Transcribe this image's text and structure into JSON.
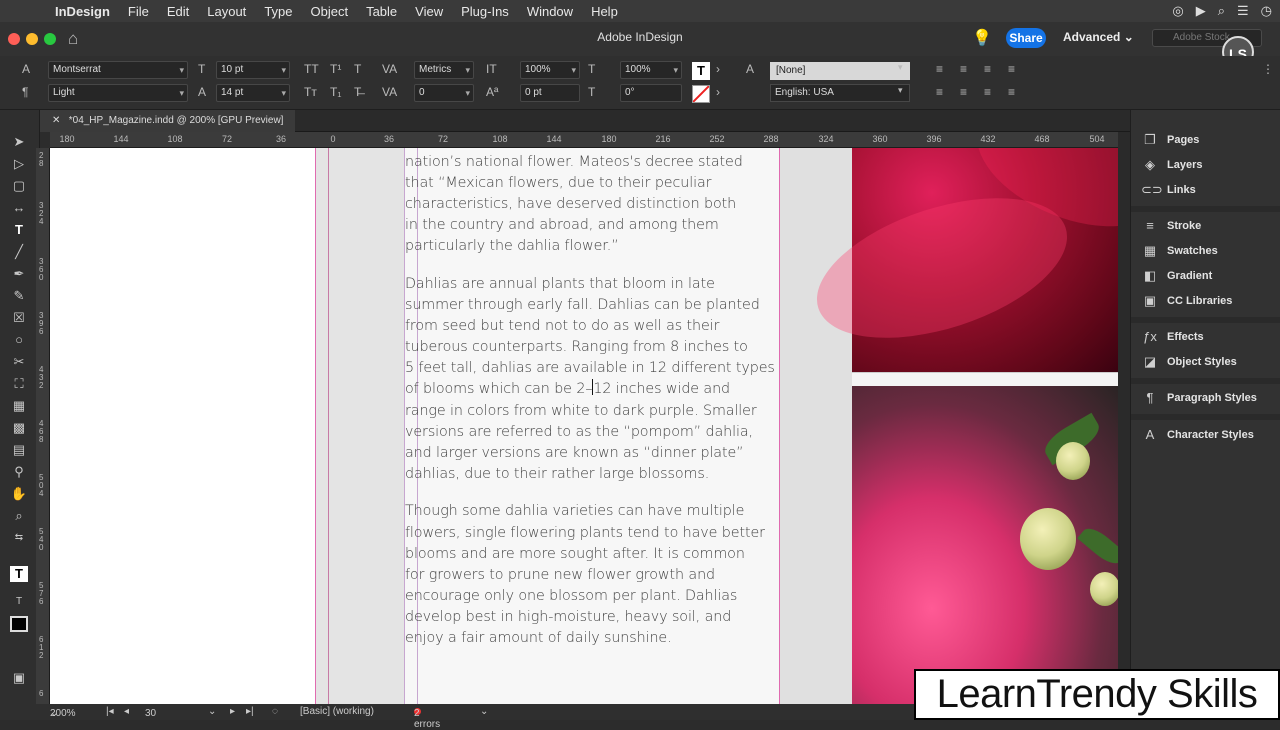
{
  "menubar": {
    "app": "InDesign",
    "items": [
      "File",
      "Edit",
      "Layout",
      "Type",
      "Object",
      "Table",
      "View",
      "Plug-Ins",
      "Window",
      "Help"
    ]
  },
  "titlebar": {
    "title": "Adobe InDesign",
    "share": "Share",
    "workspace": "Advanced",
    "stock_placeholder": "Adobe Stock",
    "badge": "LS"
  },
  "control": {
    "font_family": "Montserrat",
    "font_style": "Light",
    "font_size": "10 pt",
    "leading": "14 pt",
    "kerning": "Metrics",
    "tracking": "0",
    "vertical_scale": "100%",
    "horizontal_scale": "100%",
    "baseline_shift": "0 pt",
    "skew": "0°",
    "paragraph_style": "[None]",
    "language": "English: USA"
  },
  "document": {
    "tab": "*04_HP_Magazine.indd @ 200% [GPU Preview]"
  },
  "ruler": {
    "h_ticks": [
      "180",
      "144",
      "108",
      "72",
      "36",
      "0",
      "36",
      "72",
      "108",
      "144",
      "180",
      "216",
      "252",
      "288",
      "324",
      "360",
      "396",
      "432",
      "468",
      "504"
    ],
    "v_ticks": [
      "2\n8",
      "3\n2\n4",
      "3\n6\n0",
      "3\n9\n6",
      "4\n3\n2",
      "4\n6\n8",
      "5\n0\n4",
      "5\n4\n0",
      "5\n7\n6",
      "6\n1\n2",
      "6"
    ]
  },
  "story": {
    "p1_lines": [
      "nation’s national flower. Mateos's decree stated",
      "that “Mexican flowers, due to their peculiar",
      "characteristics, have deserved distinction both",
      "in the country and abroad, and among them",
      "particularly the dahlia flower.”"
    ],
    "p2_lines": [
      "Dahlias are annual plants that bloom in late",
      "summer through early fall. Dahlias can be planted",
      "from seed but tend not to do as well as their",
      "tuberous counterparts. Ranging from 8 inches to",
      "5 feet tall, dahlias are available in 12 different types"
    ],
    "p2_cursor_before": "of blooms which can be 2–",
    "p2_cursor_after": "12 inches wide and",
    "p2_lines_end": [
      "range in colors from white to dark purple. Smaller",
      "versions are referred to as the “pompom” dahlia,",
      "and larger versions are known as “dinner plate”",
      "dahlias, due to their rather large blossoms."
    ],
    "p3_lines": [
      "Though some dahlia varieties can have multiple",
      "flowers, single flowering plants tend to have better",
      "blooms and are more sought after. It is common",
      "for growers to prune new flower growth and",
      "encourage only one blossom per plant. Dahlias",
      "develop best in high-moisture, heavy soil, and",
      "enjoy a fair amount of daily sunshine."
    ]
  },
  "panels": [
    "Pages",
    "Layers",
    "Links",
    "Stroke",
    "Swatches",
    "Gradient",
    "CC Libraries",
    "Effects",
    "Object Styles",
    "Paragraph Styles",
    "Character Styles"
  ],
  "status": {
    "zoom": "200%",
    "page": "30",
    "style": "[Basic] (working)",
    "errors": "2 errors"
  },
  "watermark": "LearnTrendy Skills",
  "colors": {
    "accent": "#1473e6",
    "guide": "#e06bb0",
    "error": "#e33333"
  }
}
